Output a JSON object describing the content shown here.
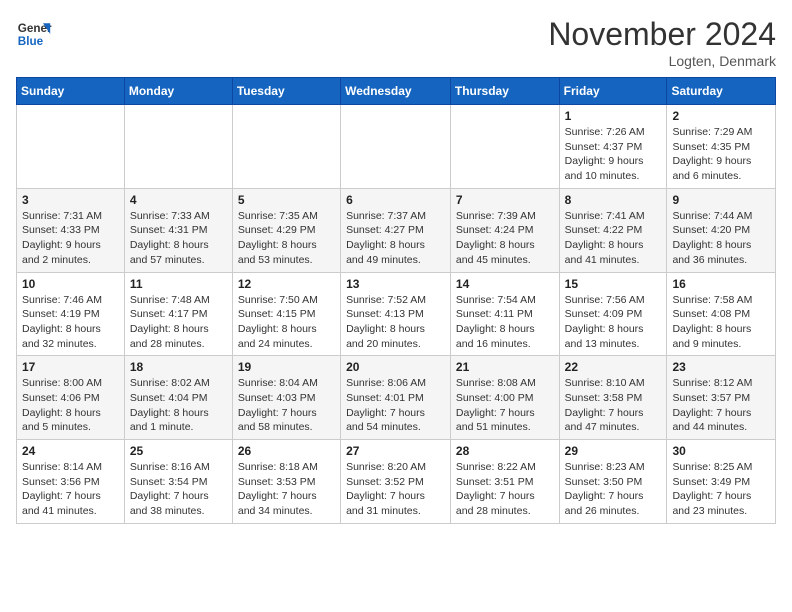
{
  "header": {
    "logo": {
      "line1": "General",
      "line2": "Blue"
    },
    "title": "November 2024",
    "location": "Logten, Denmark"
  },
  "weekdays": [
    "Sunday",
    "Monday",
    "Tuesday",
    "Wednesday",
    "Thursday",
    "Friday",
    "Saturday"
  ],
  "weeks": [
    [
      {
        "day": "",
        "info": ""
      },
      {
        "day": "",
        "info": ""
      },
      {
        "day": "",
        "info": ""
      },
      {
        "day": "",
        "info": ""
      },
      {
        "day": "",
        "info": ""
      },
      {
        "day": "1",
        "info": "Sunrise: 7:26 AM\nSunset: 4:37 PM\nDaylight: 9 hours and 10 minutes."
      },
      {
        "day": "2",
        "info": "Sunrise: 7:29 AM\nSunset: 4:35 PM\nDaylight: 9 hours and 6 minutes."
      }
    ],
    [
      {
        "day": "3",
        "info": "Sunrise: 7:31 AM\nSunset: 4:33 PM\nDaylight: 9 hours and 2 minutes."
      },
      {
        "day": "4",
        "info": "Sunrise: 7:33 AM\nSunset: 4:31 PM\nDaylight: 8 hours and 57 minutes."
      },
      {
        "day": "5",
        "info": "Sunrise: 7:35 AM\nSunset: 4:29 PM\nDaylight: 8 hours and 53 minutes."
      },
      {
        "day": "6",
        "info": "Sunrise: 7:37 AM\nSunset: 4:27 PM\nDaylight: 8 hours and 49 minutes."
      },
      {
        "day": "7",
        "info": "Sunrise: 7:39 AM\nSunset: 4:24 PM\nDaylight: 8 hours and 45 minutes."
      },
      {
        "day": "8",
        "info": "Sunrise: 7:41 AM\nSunset: 4:22 PM\nDaylight: 8 hours and 41 minutes."
      },
      {
        "day": "9",
        "info": "Sunrise: 7:44 AM\nSunset: 4:20 PM\nDaylight: 8 hours and 36 minutes."
      }
    ],
    [
      {
        "day": "10",
        "info": "Sunrise: 7:46 AM\nSunset: 4:19 PM\nDaylight: 8 hours and 32 minutes."
      },
      {
        "day": "11",
        "info": "Sunrise: 7:48 AM\nSunset: 4:17 PM\nDaylight: 8 hours and 28 minutes."
      },
      {
        "day": "12",
        "info": "Sunrise: 7:50 AM\nSunset: 4:15 PM\nDaylight: 8 hours and 24 minutes."
      },
      {
        "day": "13",
        "info": "Sunrise: 7:52 AM\nSunset: 4:13 PM\nDaylight: 8 hours and 20 minutes."
      },
      {
        "day": "14",
        "info": "Sunrise: 7:54 AM\nSunset: 4:11 PM\nDaylight: 8 hours and 16 minutes."
      },
      {
        "day": "15",
        "info": "Sunrise: 7:56 AM\nSunset: 4:09 PM\nDaylight: 8 hours and 13 minutes."
      },
      {
        "day": "16",
        "info": "Sunrise: 7:58 AM\nSunset: 4:08 PM\nDaylight: 8 hours and 9 minutes."
      }
    ],
    [
      {
        "day": "17",
        "info": "Sunrise: 8:00 AM\nSunset: 4:06 PM\nDaylight: 8 hours and 5 minutes."
      },
      {
        "day": "18",
        "info": "Sunrise: 8:02 AM\nSunset: 4:04 PM\nDaylight: 8 hours and 1 minute."
      },
      {
        "day": "19",
        "info": "Sunrise: 8:04 AM\nSunset: 4:03 PM\nDaylight: 7 hours and 58 minutes."
      },
      {
        "day": "20",
        "info": "Sunrise: 8:06 AM\nSunset: 4:01 PM\nDaylight: 7 hours and 54 minutes."
      },
      {
        "day": "21",
        "info": "Sunrise: 8:08 AM\nSunset: 4:00 PM\nDaylight: 7 hours and 51 minutes."
      },
      {
        "day": "22",
        "info": "Sunrise: 8:10 AM\nSunset: 3:58 PM\nDaylight: 7 hours and 47 minutes."
      },
      {
        "day": "23",
        "info": "Sunrise: 8:12 AM\nSunset: 3:57 PM\nDaylight: 7 hours and 44 minutes."
      }
    ],
    [
      {
        "day": "24",
        "info": "Sunrise: 8:14 AM\nSunset: 3:56 PM\nDaylight: 7 hours and 41 minutes."
      },
      {
        "day": "25",
        "info": "Sunrise: 8:16 AM\nSunset: 3:54 PM\nDaylight: 7 hours and 38 minutes."
      },
      {
        "day": "26",
        "info": "Sunrise: 8:18 AM\nSunset: 3:53 PM\nDaylight: 7 hours and 34 minutes."
      },
      {
        "day": "27",
        "info": "Sunrise: 8:20 AM\nSunset: 3:52 PM\nDaylight: 7 hours and 31 minutes."
      },
      {
        "day": "28",
        "info": "Sunrise: 8:22 AM\nSunset: 3:51 PM\nDaylight: 7 hours and 28 minutes."
      },
      {
        "day": "29",
        "info": "Sunrise: 8:23 AM\nSunset: 3:50 PM\nDaylight: 7 hours and 26 minutes."
      },
      {
        "day": "30",
        "info": "Sunrise: 8:25 AM\nSunset: 3:49 PM\nDaylight: 7 hours and 23 minutes."
      }
    ]
  ]
}
